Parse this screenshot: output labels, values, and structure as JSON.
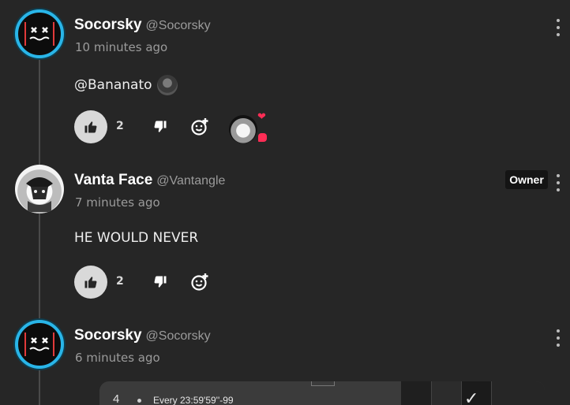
{
  "comments": [
    {
      "author": "Socorsky",
      "handle": "@Socorsky",
      "time": "10 minutes ago",
      "text": "@Bananato",
      "likes": "2",
      "avatar_icon": "skull-face-avatar"
    },
    {
      "author": "Vanta Face",
      "handle": "@Vantangle",
      "time": "7 minutes ago",
      "text": "HE WOULD NEVER",
      "likes": "2",
      "badge": "Owner",
      "avatar_icon": "hooded-figure-avatar"
    },
    {
      "author": "Socorsky",
      "handle": "@Socorsky",
      "time": "6 minutes ago",
      "avatar_icon": "skull-face-avatar"
    }
  ],
  "attachment": {
    "row_number": "4",
    "row_text": "Every 23:59'59''-99"
  },
  "colors": {
    "background": "#262626",
    "heart": "#ff2d55",
    "avatar_ring": "#29b5e8",
    "like_button": "#d9d9d9"
  }
}
